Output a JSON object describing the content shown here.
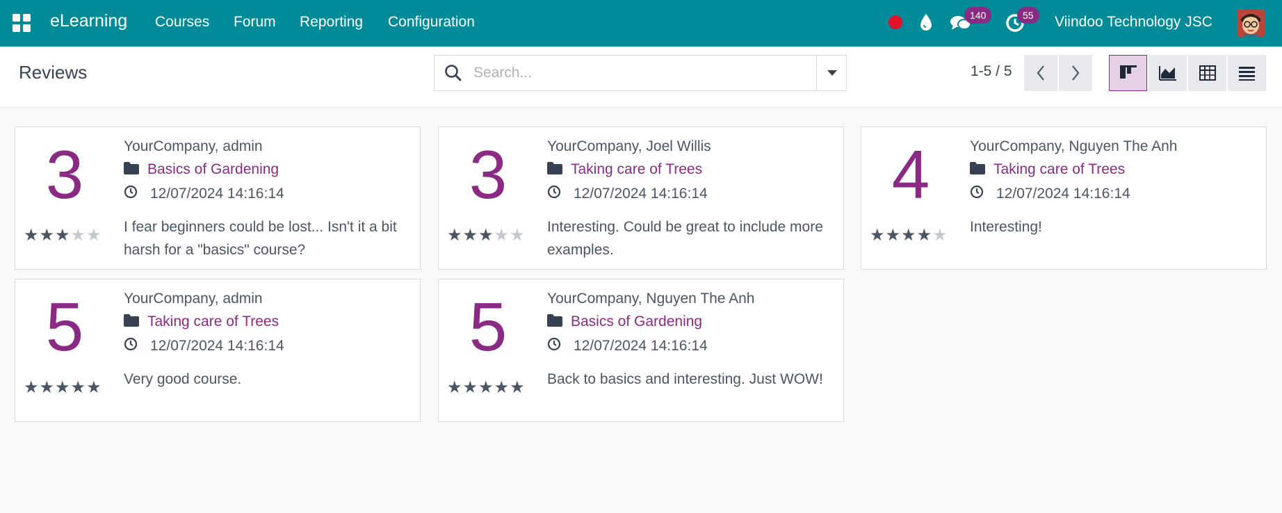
{
  "navbar": {
    "brand": "eLearning",
    "menu": [
      "Courses",
      "Forum",
      "Reporting",
      "Configuration"
    ],
    "messages_count": "140",
    "activities_count": "55",
    "company": "Viindoo Technology JSC",
    "icons": [
      "apps-icon",
      "record-icon",
      "water-drop-icon",
      "chat-icon",
      "clock-icon",
      "avatar"
    ]
  },
  "control": {
    "title": "Reviews",
    "search_placeholder": "Search...",
    "pager": "1-5 / 5",
    "views": [
      "kanban-view-icon",
      "graph-view-icon",
      "pivot-view-icon",
      "list-view-icon"
    ],
    "active_view": "kanban"
  },
  "colors": {
    "navbar": "#018b99",
    "accent": "#8a2a85",
    "record": "#e3122b"
  },
  "reviews": [
    {
      "rating": "3",
      "stars": 3,
      "author": "YourCompany, admin",
      "course": "Basics of Gardening",
      "date": "12/07/2024 14:16:14",
      "comment": "I fear beginners could be lost... Isn't it a bit harsh for a \"basics\" course?"
    },
    {
      "rating": "3",
      "stars": 3,
      "author": "YourCompany, Joel Willis",
      "course": "Taking care of Trees",
      "date": "12/07/2024 14:16:14",
      "comment": "Interesting. Could be great to include more examples."
    },
    {
      "rating": "4",
      "stars": 4,
      "author": "YourCompany, Nguyen The Anh",
      "course": "Taking care of Trees",
      "date": "12/07/2024 14:16:14",
      "comment": "Interesting!"
    },
    {
      "rating": "5",
      "stars": 5,
      "author": "YourCompany, admin",
      "course": "Taking care of Trees",
      "date": "12/07/2024 14:16:14",
      "comment": "Very good course."
    },
    {
      "rating": "5",
      "stars": 5,
      "author": "YourCompany, Nguyen The Anh",
      "course": "Basics of Gardening",
      "date": "12/07/2024 14:16:14",
      "comment": "Back to basics and interesting. Just WOW!"
    }
  ]
}
